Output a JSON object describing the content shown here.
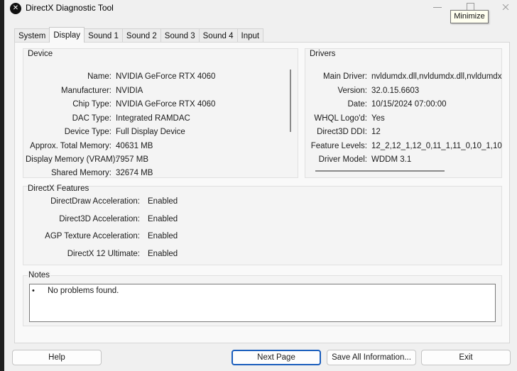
{
  "window": {
    "title": "DirectX Diagnostic Tool",
    "tooltip": "Minimize"
  },
  "tabs": [
    {
      "label": "System"
    },
    {
      "label": "Display"
    },
    {
      "label": "Sound 1"
    },
    {
      "label": "Sound 2"
    },
    {
      "label": "Sound 3"
    },
    {
      "label": "Sound 4"
    },
    {
      "label": "Input"
    }
  ],
  "active_tab": "Display",
  "device": {
    "title": "Device",
    "rows": [
      {
        "label": "Name:",
        "value": "NVIDIA GeForce RTX 4060"
      },
      {
        "label": "Manufacturer:",
        "value": "NVIDIA"
      },
      {
        "label": "Chip Type:",
        "value": "NVIDIA GeForce RTX 4060"
      },
      {
        "label": "DAC Type:",
        "value": "Integrated RAMDAC"
      },
      {
        "label": "Device Type:",
        "value": "Full Display Device"
      },
      {
        "label": "Approx. Total Memory:",
        "value": "40631 MB"
      },
      {
        "label": "Display Memory (VRAM):",
        "value": "7957 MB"
      },
      {
        "label": "Shared Memory:",
        "value": "32674 MB"
      }
    ]
  },
  "drivers": {
    "title": "Drivers",
    "rows": [
      {
        "label": "Main Driver:",
        "value": "nvldumdx.dll,nvldumdx.dll,nvldumdx.d"
      },
      {
        "label": "Version:",
        "value": "32.0.15.6603"
      },
      {
        "label": "Date:",
        "value": "10/15/2024 07:00:00"
      },
      {
        "label": "WHQL Logo'd:",
        "value": "Yes"
      },
      {
        "label": "Direct3D DDI:",
        "value": "12"
      },
      {
        "label": "Feature Levels:",
        "value": "12_2,12_1,12_0,11_1,11_0,10_1,10"
      },
      {
        "label": "Driver Model:",
        "value": "WDDM 3.1"
      }
    ]
  },
  "features": {
    "title": "DirectX Features",
    "rows": [
      {
        "label": "DirectDraw Acceleration:",
        "value": "Enabled"
      },
      {
        "label": "Direct3D Acceleration:",
        "value": "Enabled"
      },
      {
        "label": "AGP Texture Acceleration:",
        "value": "Enabled"
      },
      {
        "label": "DirectX 12 Ultimate:",
        "value": "Enabled"
      }
    ]
  },
  "notes": {
    "title": "Notes",
    "bullet": "•",
    "items": [
      "No problems found."
    ]
  },
  "buttons": {
    "help": "Help",
    "next_page": "Next Page",
    "save_all": "Save All Information...",
    "exit": "Exit"
  },
  "icons": {
    "app": "directx-icon",
    "close": "close-icon",
    "maximize": "maximize-icon"
  }
}
